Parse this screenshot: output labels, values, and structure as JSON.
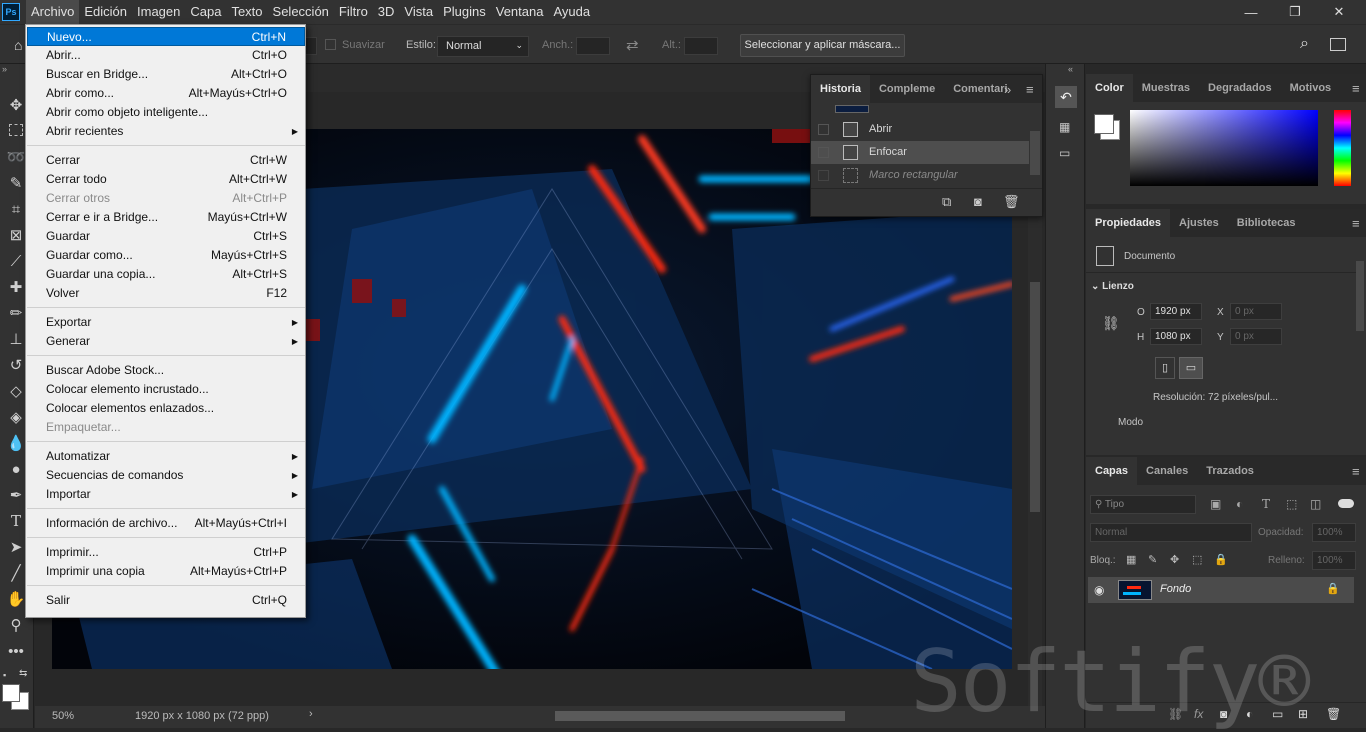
{
  "app": {
    "logo": "Ps"
  },
  "menubar": {
    "items": [
      "Archivo",
      "Edición",
      "Imagen",
      "Capa",
      "Texto",
      "Selección",
      "Filtro",
      "3D",
      "Vista",
      "Plugins",
      "Ventana",
      "Ayuda"
    ]
  },
  "window_controls": {
    "minimize": "—",
    "restore": "❐",
    "close": "✕"
  },
  "options_bar": {
    "antialias_label": "Suavizar",
    "style_label": "Estilo:",
    "style_value": "Normal",
    "width_label": "Anch.:",
    "height_label": "Alt.:",
    "select_mask_button": "Seleccionar y aplicar máscara..."
  },
  "file_menu": {
    "items": [
      {
        "label": "Nuevo...",
        "shortcut": "Ctrl+N",
        "highlighted": true
      },
      {
        "label": "Abrir...",
        "shortcut": "Ctrl+O"
      },
      {
        "label": "Buscar en Bridge...",
        "shortcut": "Alt+Ctrl+O"
      },
      {
        "label": "Abrir como...",
        "shortcut": "Alt+Mayús+Ctrl+O"
      },
      {
        "label": "Abrir como objeto inteligente...",
        "shortcut": ""
      },
      {
        "label": "Abrir recientes",
        "shortcut": "",
        "submenu": true
      },
      {
        "label": "Cerrar",
        "shortcut": "Ctrl+W"
      },
      {
        "label": "Cerrar todo",
        "shortcut": "Alt+Ctrl+W"
      },
      {
        "label": "Cerrar otros",
        "shortcut": "Alt+Ctrl+P",
        "disabled": true
      },
      {
        "label": "Cerrar e ir a Bridge...",
        "shortcut": "Mayús+Ctrl+W"
      },
      {
        "label": "Guardar",
        "shortcut": "Ctrl+S"
      },
      {
        "label": "Guardar como...",
        "shortcut": "Mayús+Ctrl+S"
      },
      {
        "label": "Guardar una copia...",
        "shortcut": "Alt+Ctrl+S"
      },
      {
        "label": "Volver",
        "shortcut": "F12"
      },
      {
        "label": "Exportar",
        "shortcut": "",
        "submenu": true
      },
      {
        "label": "Generar",
        "shortcut": "",
        "submenu": true
      },
      {
        "label": "Buscar Adobe Stock...",
        "shortcut": ""
      },
      {
        "label": "Colocar elemento incrustado...",
        "shortcut": ""
      },
      {
        "label": "Colocar elementos enlazados...",
        "shortcut": ""
      },
      {
        "label": "Empaquetar...",
        "shortcut": "",
        "disabled": true
      },
      {
        "label": "Automatizar",
        "shortcut": "",
        "submenu": true
      },
      {
        "label": "Secuencias de comandos",
        "shortcut": "",
        "submenu": true
      },
      {
        "label": "Importar",
        "shortcut": "",
        "submenu": true
      },
      {
        "label": "Información de archivo...",
        "shortcut": "Alt+Mayús+Ctrl+I"
      },
      {
        "label": "Imprimir...",
        "shortcut": "Ctrl+P"
      },
      {
        "label": "Imprimir una copia",
        "shortcut": "Alt+Mayús+Ctrl+P"
      },
      {
        "label": "Salir",
        "shortcut": "Ctrl+Q"
      }
    ]
  },
  "history_panel": {
    "tabs": [
      "Historia",
      "Compleme",
      "Comentari"
    ],
    "states": [
      "Abrir",
      "Enfocar",
      "Marco rectangular"
    ]
  },
  "color_panel": {
    "tabs": [
      "Color",
      "Muestras",
      "Degradados",
      "Motivos"
    ]
  },
  "properties_panel": {
    "tabs": [
      "Propiedades",
      "Ajustes",
      "Bibliotecas"
    ],
    "doc_label": "Documento",
    "section_label": "Lienzo",
    "w_label": "O",
    "w_value": "1920 px",
    "h_label": "H",
    "h_value": "1080 px",
    "x_label": "X",
    "x_value": "0 px",
    "y_label": "Y",
    "y_value": "0 px",
    "resolution_text": "Resolución: 72 píxeles/pul...",
    "mode_label": "Modo"
  },
  "layers_panel": {
    "tabs": [
      "Capas",
      "Canales",
      "Trazados"
    ],
    "filter_placeholder": "Tipo",
    "blend_mode": "Normal",
    "opacity_label": "Opacidad:",
    "opacity_value": "100%",
    "lock_label": "Bloq.:",
    "fill_label": "Relleno:",
    "fill_value": "100%",
    "layer_name": "Fondo"
  },
  "status_bar": {
    "zoom": "50%",
    "doc_info": "1920 px x 1080 px (72 ppp)"
  },
  "watermark": "Softify®",
  "colors": {
    "menu_highlight": "#0078d7",
    "panel_bg": "#323232",
    "app_bg": "#282828"
  }
}
